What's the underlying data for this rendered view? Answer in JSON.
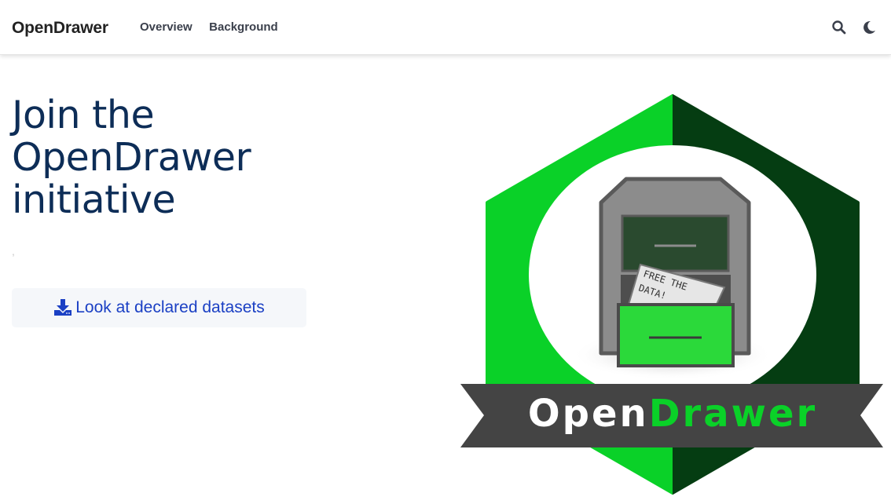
{
  "nav": {
    "brand": "OpenDrawer",
    "links": [
      "Overview",
      "Background"
    ],
    "icons": [
      "search-icon",
      "moon-icon"
    ]
  },
  "hero": {
    "title": "Join the OpenDrawer initiative",
    "subtitle": ",",
    "cta_label": "Look at declared datasets",
    "cta_icon": "download-icon"
  },
  "logo": {
    "paper_text_line1": "FREE THE",
    "paper_text_line2": "DATA!",
    "banner_left": "Open",
    "banner_right": "Drawer"
  },
  "colors": {
    "title": "#0d2d57",
    "link": "#1b40c4",
    "green_bright": "#0ad128",
    "green_dark": "#053d12",
    "banner": "#444444"
  }
}
